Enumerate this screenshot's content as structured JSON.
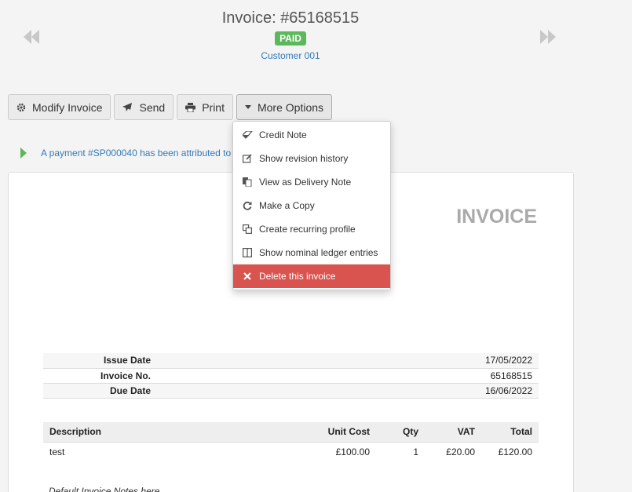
{
  "header": {
    "title": "Invoice: #65168515",
    "status_badge": "PAID",
    "customer": "Customer 001"
  },
  "toolbar": {
    "modify_label": "Modify Invoice",
    "send_label": "Send",
    "print_label": "Print",
    "more_label": "More Options"
  },
  "notice": {
    "text": "A payment #SP000040 has been attributed to"
  },
  "menu": {
    "items": [
      {
        "label": "Credit Note",
        "icon": "eraser-icon"
      },
      {
        "label": "Show revision history",
        "icon": "edit-icon"
      },
      {
        "label": "View as Delivery Note",
        "icon": "copy-file-icon"
      },
      {
        "label": "Make a Copy",
        "icon": "refresh-icon"
      },
      {
        "label": "Create recurring profile",
        "icon": "duplicate-icon"
      },
      {
        "label": "Show nominal ledger entries",
        "icon": "columns-icon"
      },
      {
        "label": "Delete this invoice",
        "icon": "close-icon"
      }
    ]
  },
  "invoice": {
    "doc_title": "INVOICE",
    "meta": [
      {
        "key": "Issue Date",
        "value": "17/05/2022"
      },
      {
        "key": "Invoice No.",
        "value": "65168515"
      },
      {
        "key": "Due Date",
        "value": "16/06/2022"
      }
    ],
    "columns": [
      "Description",
      "Unit Cost",
      "Qty",
      "VAT",
      "Total"
    ],
    "lines": [
      {
        "description": "test",
        "unit_cost": "£100.00",
        "qty": "1",
        "vat": "£20.00",
        "total": "£120.00"
      }
    ],
    "notes": "Default Invoice Notes here"
  },
  "colors": {
    "paid": "#5cb85c",
    "link": "#337ab7",
    "danger": "#d9534f",
    "notice_arrow": "#5cb85c"
  }
}
